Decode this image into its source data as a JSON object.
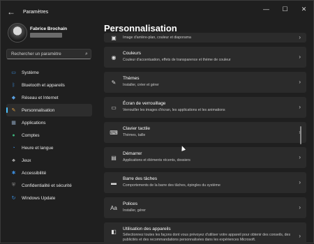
{
  "window": {
    "title": "Paramètres",
    "controls": {
      "minimize": "—",
      "maximize": "☐",
      "close": "✕"
    }
  },
  "profile": {
    "name": "Fabrice Brochain"
  },
  "search": {
    "placeholder": "Rechercher un paramètre"
  },
  "sidebar": {
    "items": [
      {
        "label": "Système",
        "icon": "system-icon",
        "color": "#3b8ddd"
      },
      {
        "label": "Bluetooth et appareils",
        "icon": "bluetooth-icon",
        "color": "#3b8ddd"
      },
      {
        "label": "Réseau et Internet",
        "icon": "wifi-icon",
        "color": "#5aa0e0"
      },
      {
        "label": "Personnalisation",
        "icon": "brush-icon",
        "color": "#e0a040",
        "active": true
      },
      {
        "label": "Applications",
        "icon": "apps-icon",
        "color": "#8aa0b8"
      },
      {
        "label": "Comptes",
        "icon": "person-icon",
        "color": "#3bb07a"
      },
      {
        "label": "Heure et langue",
        "icon": "globe-clock-icon",
        "color": "#3b8ddd"
      },
      {
        "label": "Jeux",
        "icon": "gamepad-icon",
        "color": "#aaaaaa"
      },
      {
        "label": "Accessibilité",
        "icon": "accessibility-icon",
        "color": "#3b8ddd"
      },
      {
        "label": "Confidentialité et sécurité",
        "icon": "shield-icon",
        "color": "#8a8a8a"
      },
      {
        "label": "Windows Update",
        "icon": "update-icon",
        "color": "#3b8ddd"
      }
    ]
  },
  "main": {
    "title": "Personnalisation",
    "cards": [
      {
        "title": "",
        "subtitle": "Image d'arrière-plan, couleur et diaporama",
        "icon": "image-icon"
      },
      {
        "title": "Couleurs",
        "subtitle": "Couleur d'accentuation, effets de transparence et thème de couleur",
        "icon": "palette-icon"
      },
      {
        "title": "Thèmes",
        "subtitle": "Installer, créer et gérer",
        "icon": "pen-icon"
      },
      {
        "title": "Écran de verrouillage",
        "subtitle": "Verrouiller les images d'écran, les applications et les animations",
        "icon": "lockscreen-icon"
      },
      {
        "title": "Clavier tactile",
        "subtitle": "Thèmes, taille",
        "icon": "keyboard-icon"
      },
      {
        "title": "Démarrer",
        "subtitle": "Applications et éléments récents, dossiers",
        "icon": "start-icon"
      },
      {
        "title": "Barre des tâches",
        "subtitle": "Comportements de la barre des tâches, épingles du système",
        "icon": "taskbar-icon"
      },
      {
        "title": "Polices",
        "subtitle": "Installer, gérer",
        "icon": "font-icon"
      },
      {
        "title": "Utilisation des appareils",
        "subtitle": "Sélectionnez toutes les façons dont vous prévoyez d'utiliser votre appareil pour obtenir des conseils, des publicités et des recommandations personnalisées dans les expériences Microsoft.",
        "icon": "device-usage-icon"
      }
    ]
  }
}
